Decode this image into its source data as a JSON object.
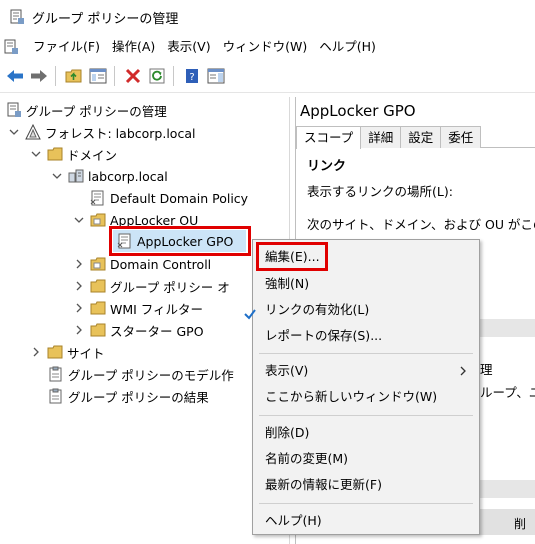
{
  "window": {
    "title": "グループ ポリシーの管理"
  },
  "menu": [
    "ファイル(F)",
    "操作(A)",
    "表示(V)",
    "ウィンドウ(W)",
    "ヘルプ(H)"
  ],
  "tree": {
    "root": "グループ ポリシーの管理",
    "forest": "フォレスト: labcorp.local",
    "domains": "ドメイン",
    "domain": "labcorp.local",
    "default_policy": "Default Domain Policy",
    "ou": "AppLocker OU",
    "gpo_link": "AppLocker GPO",
    "dc": "Domain Controll",
    "gpo_objects": "グループ ポリシー オ",
    "wmi": "WMI フィルター",
    "starter": "スターター GPO",
    "sites": "サイト",
    "modeling": "グループ ポリシーのモデル作",
    "results": "グループ ポリシーの結果"
  },
  "right": {
    "title": "AppLocker GPO",
    "tabs": [
      "スコープ",
      "詳細",
      "設定",
      "委任"
    ],
    "section": "リンク",
    "display_links_label": "表示するリンクの場所(L):",
    "sites_text": "次のサイト、ドメイン、および OU がこの G",
    "frag_1": "理",
    "frag_2": "ループ、ユー",
    "frag_3": "削"
  },
  "context_menu": {
    "edit": "編集(E)...",
    "enforce": "強制(N)",
    "link_enabled": "リンクの有効化(L)",
    "save_report": "レポートの保存(S)...",
    "view": "表示(V)",
    "new_window": "ここから新しいウィンドウ(W)",
    "delete": "削除(D)",
    "rename": "名前の変更(M)",
    "refresh": "最新の情報に更新(F)",
    "help": "ヘルプ(H)"
  },
  "colors": {
    "highlight_red": "#e00000",
    "selection_blue": "#cce4f7",
    "check_blue": "#1e6fc8"
  }
}
